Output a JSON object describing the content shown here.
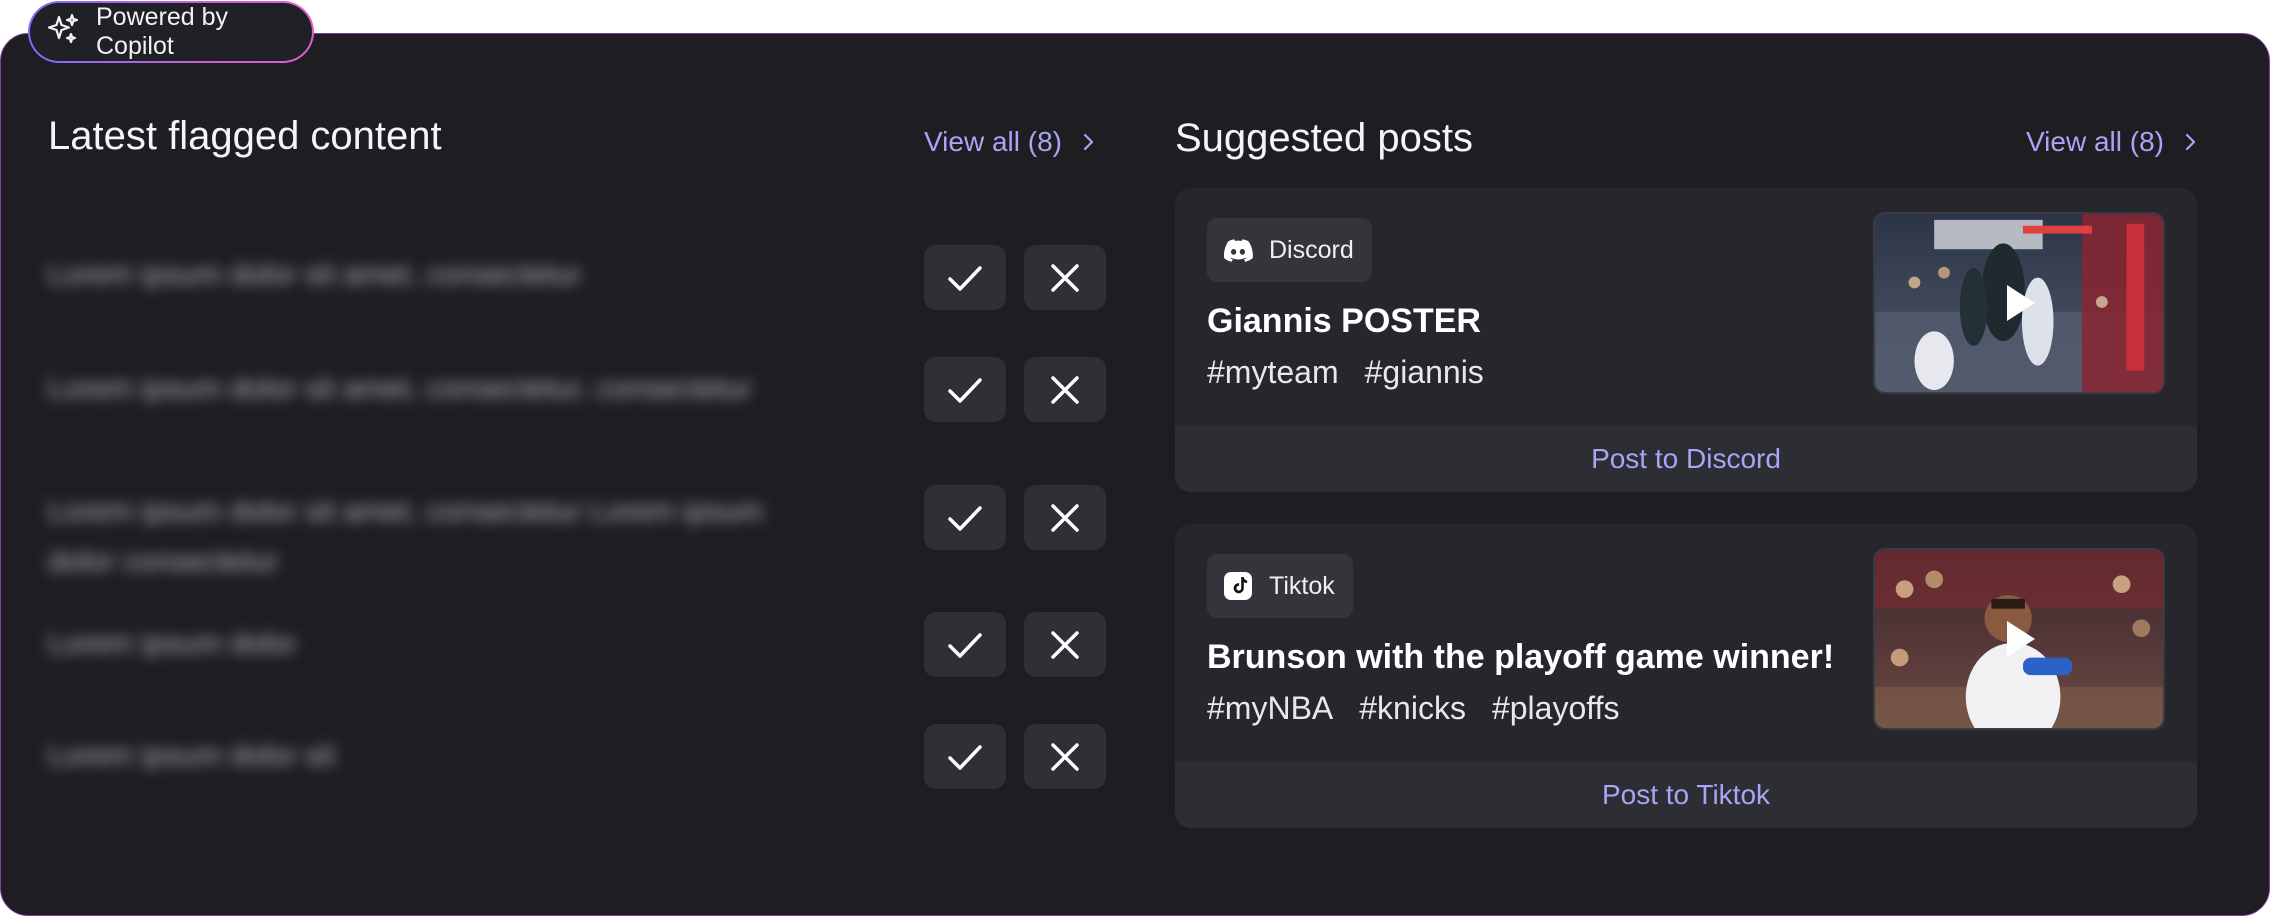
{
  "badge": {
    "label": "Powered by Copilot",
    "icon": "sparkle-icon"
  },
  "flagged": {
    "title": "Latest flagged content",
    "view_all": "View all (8)",
    "items": [
      {
        "text": "Lorem ipsum dolor sit amet, consectetur"
      },
      {
        "text": "Lorem ipsum dolor sit amet, consectetur, consectetur"
      },
      {
        "text": "Lorem ipsum dolor sit amet, consectetur Lorem ipsum dolor consectetur"
      },
      {
        "text": "Lorem ipsum dolor"
      },
      {
        "text": "Lorem ipsum dolor sit"
      }
    ]
  },
  "suggested": {
    "title": "Suggested posts",
    "view_all": "View all (8)",
    "posts": [
      {
        "platform": "Discord",
        "platform_icon": "discord-icon",
        "title": "Giannis POSTER",
        "tags": [
          "#myteam",
          "#giannis"
        ],
        "action": "Post to Discord"
      },
      {
        "platform": "Tiktok",
        "platform_icon": "tiktok-icon",
        "title": "Brunson with the playoff game winner!",
        "tags": [
          "#myNBA",
          "#knicks",
          "#playoffs"
        ],
        "action": "Post to Tiktok"
      }
    ]
  },
  "colors": {
    "accent": "#a9a4f3",
    "panel": "#1d1d22",
    "card": "#26262c"
  }
}
